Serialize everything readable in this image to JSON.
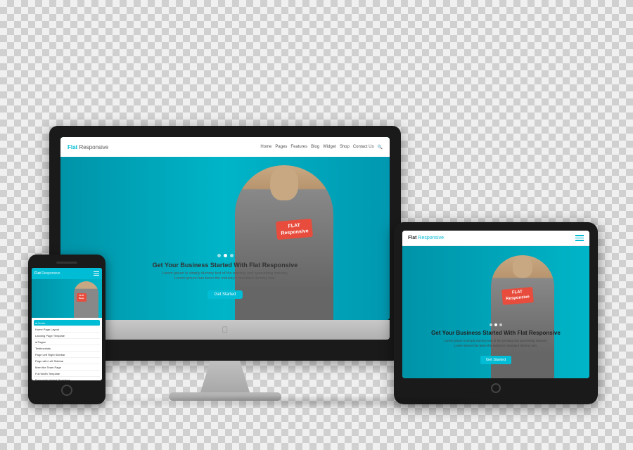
{
  "scene": {
    "background": "checkered"
  },
  "brand": {
    "name_bold": "Flat",
    "name_light": " Responsive"
  },
  "nav": {
    "links": [
      "Home",
      "Pages",
      "Features",
      "Blog",
      "Widget",
      "Shop",
      "Contact Us"
    ]
  },
  "hero": {
    "badge_line1": "FLAT",
    "badge_line2": "Responsive",
    "title": "Get Your Business Started With Flat Responsive",
    "subtitle_line1": "Lorem ipsum is simply dummy text of the printing and typesetting industry.",
    "subtitle_line2": "Lorem ipsum has been the industry's standard dummy text.",
    "cta_button": "Get Started"
  },
  "iphone": {
    "menu_items": [
      "Home",
      "Home Page Layout",
      "Landing Page Template",
      "Pages",
      "Testimonials",
      "Page Left Right Sidebar",
      "Page with Left Sidebar",
      "Meet the Team Page",
      "Full Width Template",
      "Frequently Asked Questions"
    ]
  },
  "ipad": {
    "title": "Get Your Business Started With Flat Responsive",
    "subtitle_line1": "Lorem ipsum is simply dummy text of the printing and typesetting industry.",
    "subtitle_line2": "Lorem ipsum has been the industry's standard dummy text.",
    "cta_button": "Get Started"
  }
}
